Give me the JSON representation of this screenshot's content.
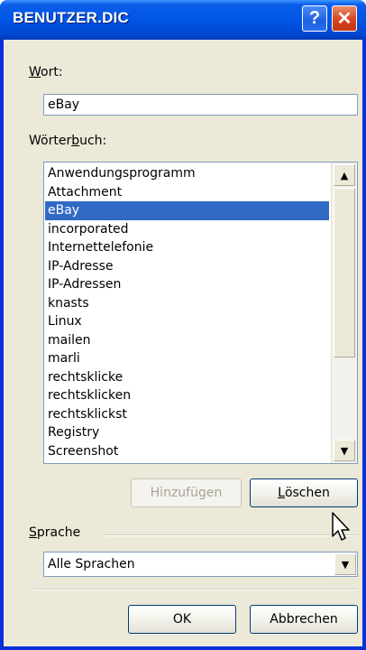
{
  "window": {
    "title": "BENUTZER.DIC",
    "help_label": "?",
    "close_label": "✕"
  },
  "word": {
    "label_prefix": "W",
    "label_rest": "ort:",
    "value": "eBay"
  },
  "dictionary": {
    "label_prefix": "Wörter",
    "label_underlined": "b",
    "label_rest": "uch:",
    "items": [
      "Anwendungsprogramm",
      "Attachment",
      "eBay",
      "incorporated",
      "Internettelefonie",
      "IP-Adresse",
      "IP-Adressen",
      "knasts",
      "Linux",
      "mailen",
      "marli",
      "rechtsklicke",
      "rechtsklicken",
      "rechtsklickst",
      "Registry",
      "Screenshot"
    ],
    "selected_index": 2
  },
  "buttons": {
    "add_label": "Hinzufügen",
    "delete_label_u": "L",
    "delete_label_rest": "öschen",
    "ok_label": "OK",
    "cancel_label": "Abbrechen"
  },
  "language": {
    "label_u": "S",
    "label_rest": "prache",
    "value": "Alle Sprachen"
  },
  "icons": {
    "scroll_up": "▲",
    "scroll_down": "▼",
    "dropdown": "▼"
  }
}
